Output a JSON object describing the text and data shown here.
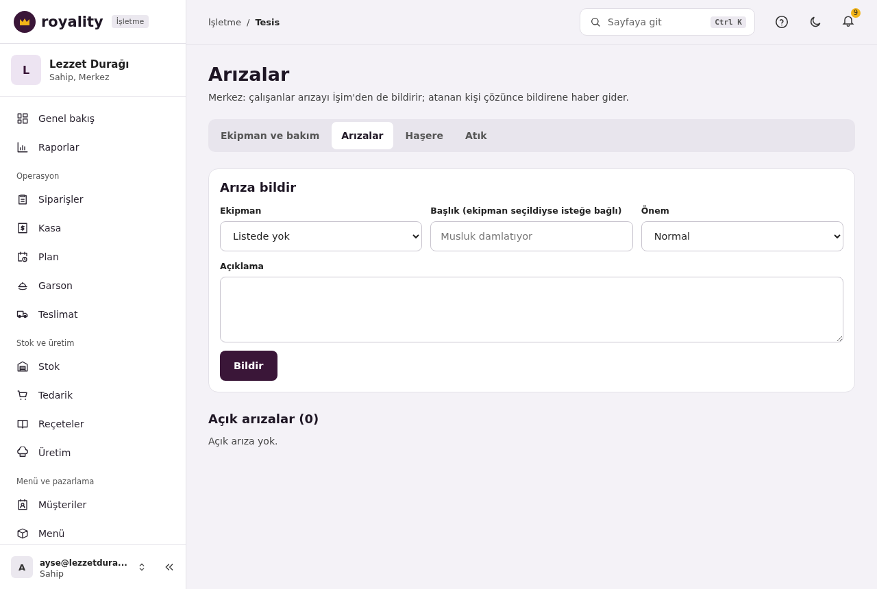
{
  "brand": {
    "name": "royality",
    "badge": "İşletme"
  },
  "org": {
    "initial": "L",
    "name": "Lezzet Durağı",
    "role": "Sahip, Merkez"
  },
  "sidebar": {
    "sections": [
      {
        "items": [
          {
            "label": "Genel bakış"
          },
          {
            "label": "Raporlar"
          }
        ]
      },
      {
        "title": "Operasyon",
        "items": [
          {
            "label": "Siparişler"
          },
          {
            "label": "Kasa"
          },
          {
            "label": "Plan"
          },
          {
            "label": "Garson"
          },
          {
            "label": "Teslimat"
          }
        ]
      },
      {
        "title": "Stok ve üretim",
        "items": [
          {
            "label": "Stok"
          },
          {
            "label": "Tedarik"
          },
          {
            "label": "Reçeteler"
          },
          {
            "label": "Üretim"
          }
        ]
      },
      {
        "title": "Menü ve pazarlama",
        "items": [
          {
            "label": "Müşteriler"
          },
          {
            "label": "Menü"
          }
        ]
      }
    ]
  },
  "user": {
    "initial": "A",
    "email": "ayse@lezzetdura...",
    "role": "Sahip"
  },
  "breadcrumb": [
    "İşletme",
    "/",
    "Tesis"
  ],
  "search": {
    "placeholder": "Sayfaya git",
    "shortcut": "Ctrl K"
  },
  "notifications": {
    "count": "9"
  },
  "page": {
    "title": "Arızalar",
    "subtitle": "Merkez: çalışanlar arızayı İşim'den de bildirir; atanan kişi çözünce bildirene haber gider."
  },
  "tabs": [
    {
      "label": "Ekipman ve bakım",
      "selected": false
    },
    {
      "label": "Arızalar",
      "selected": true
    },
    {
      "label": "Haşere",
      "selected": false
    },
    {
      "label": "Atık",
      "selected": false
    }
  ],
  "form": {
    "title": "Arıza bildir",
    "fields": [
      {
        "kind": "select",
        "label": "Ekipman",
        "value": "Listede yok"
      },
      {
        "kind": "input",
        "label": "Başlık (ekipman seçildiyse isteğe bağlı)",
        "placeholder": "Musluk damlatıyor"
      },
      {
        "kind": "select",
        "label": "Önem",
        "value": "Normal"
      }
    ],
    "description_label": "Açıklama",
    "submit": "Bildir"
  },
  "open_faults": {
    "title": "Açık arızalar (0)",
    "empty": "Açık arıza yok."
  }
}
